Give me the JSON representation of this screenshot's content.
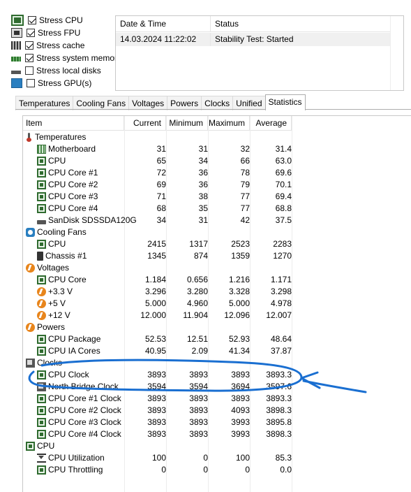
{
  "stress_options": [
    {
      "label": "Stress CPU",
      "checked": true,
      "icon": "cpu-icon"
    },
    {
      "label": "Stress FPU",
      "checked": true,
      "icon": "fpu-icon"
    },
    {
      "label": "Stress cache",
      "checked": true,
      "icon": "cache-icon"
    },
    {
      "label": "Stress system memory",
      "checked": true,
      "icon": "memory-icon"
    },
    {
      "label": "Stress local disks",
      "checked": false,
      "icon": "disk-icon"
    },
    {
      "label": "Stress GPU(s)",
      "checked": false,
      "icon": "monitor-icon"
    }
  ],
  "status_table": {
    "headers": {
      "datetime": "Date & Time",
      "status": "Status"
    },
    "row": {
      "datetime": "14.03.2024 11:22:02",
      "status": "Stability Test: Started"
    }
  },
  "tabs": [
    {
      "label": "Temperatures",
      "active": false
    },
    {
      "label": "Cooling Fans",
      "active": false
    },
    {
      "label": "Voltages",
      "active": false
    },
    {
      "label": "Powers",
      "active": false
    },
    {
      "label": "Clocks",
      "active": false
    },
    {
      "label": "Unified",
      "active": false
    },
    {
      "label": "Statistics",
      "active": true
    }
  ],
  "grid": {
    "headers": {
      "item": "Item",
      "current": "Current",
      "minimum": "Minimum",
      "maximum": "Maximum",
      "average": "Average"
    },
    "rows": [
      {
        "type": "group",
        "label": "Temperatures",
        "icon": "thermometer-icon"
      },
      {
        "type": "item",
        "label": "Motherboard",
        "icon": "motherboard-icon",
        "values": [
          "31",
          "31",
          "32",
          "31.4"
        ]
      },
      {
        "type": "item",
        "label": "CPU",
        "icon": "cpu-chip-icon",
        "values": [
          "65",
          "34",
          "66",
          "63.0"
        ]
      },
      {
        "type": "item",
        "label": "CPU Core #1",
        "icon": "cpu-chip-icon",
        "values": [
          "72",
          "36",
          "78",
          "69.6"
        ]
      },
      {
        "type": "item",
        "label": "CPU Core #2",
        "icon": "cpu-chip-icon",
        "values": [
          "69",
          "36",
          "79",
          "70.1"
        ]
      },
      {
        "type": "item",
        "label": "CPU Core #3",
        "icon": "cpu-chip-icon",
        "values": [
          "71",
          "38",
          "77",
          "69.4"
        ]
      },
      {
        "type": "item",
        "label": "CPU Core #4",
        "icon": "cpu-chip-icon",
        "values": [
          "68",
          "35",
          "77",
          "68.8"
        ]
      },
      {
        "type": "item",
        "label": "SanDisk SDSSDA120G",
        "icon": "disk-icon",
        "values": [
          "34",
          "31",
          "42",
          "37.5"
        ]
      },
      {
        "type": "group",
        "label": "Cooling Fans",
        "icon": "fan-icon"
      },
      {
        "type": "item",
        "label": "CPU",
        "icon": "cpu-chip-icon",
        "values": [
          "2415",
          "1317",
          "2523",
          "2283"
        ]
      },
      {
        "type": "item",
        "label": "Chassis #1",
        "icon": "chassis-icon",
        "values": [
          "1345",
          "874",
          "1359",
          "1270"
        ]
      },
      {
        "type": "group",
        "label": "Voltages",
        "icon": "voltage-icon"
      },
      {
        "type": "item",
        "label": "CPU Core",
        "icon": "cpu-chip-icon",
        "values": [
          "1.184",
          "0.656",
          "1.216",
          "1.171"
        ]
      },
      {
        "type": "item",
        "label": "+3.3 V",
        "icon": "voltage-icon",
        "values": [
          "3.296",
          "3.280",
          "3.328",
          "3.298"
        ]
      },
      {
        "type": "item",
        "label": "+5 V",
        "icon": "voltage-icon",
        "values": [
          "5.000",
          "4.960",
          "5.000",
          "4.978"
        ]
      },
      {
        "type": "item",
        "label": "+12 V",
        "icon": "voltage-icon",
        "values": [
          "12.000",
          "11.904",
          "12.096",
          "12.007"
        ]
      },
      {
        "type": "group",
        "label": "Powers",
        "icon": "voltage-icon"
      },
      {
        "type": "item",
        "label": "CPU Package",
        "icon": "cpu-chip-icon",
        "values": [
          "52.53",
          "12.51",
          "52.93",
          "48.64"
        ]
      },
      {
        "type": "item",
        "label": "CPU IA Cores",
        "icon": "cpu-chip-icon",
        "values": [
          "40.95",
          "2.09",
          "41.34",
          "37.87"
        ]
      },
      {
        "type": "group",
        "label": "Clocks",
        "icon": "clock-chip-icon"
      },
      {
        "type": "item",
        "label": "CPU Clock",
        "icon": "cpu-chip-icon",
        "values": [
          "3893",
          "3893",
          "3893",
          "3893.3"
        ]
      },
      {
        "type": "item",
        "label": "North Bridge Clock",
        "icon": "clock-chip-icon",
        "values": [
          "3594",
          "3594",
          "3694",
          "3597.6"
        ]
      },
      {
        "type": "item",
        "label": "CPU Core #1 Clock",
        "icon": "cpu-chip-icon",
        "values": [
          "3893",
          "3893",
          "3893",
          "3893.3"
        ]
      },
      {
        "type": "item",
        "label": "CPU Core #2 Clock",
        "icon": "cpu-chip-icon",
        "values": [
          "3893",
          "3893",
          "4093",
          "3898.3"
        ]
      },
      {
        "type": "item",
        "label": "CPU Core #3 Clock",
        "icon": "cpu-chip-icon",
        "values": [
          "3893",
          "3893",
          "3993",
          "3895.8"
        ]
      },
      {
        "type": "item",
        "label": "CPU Core #4 Clock",
        "icon": "cpu-chip-icon",
        "values": [
          "3893",
          "3893",
          "3993",
          "3898.3"
        ]
      },
      {
        "type": "group",
        "label": "CPU",
        "icon": "cpu-chip-icon"
      },
      {
        "type": "item",
        "label": "CPU Utilization",
        "icon": "hourglass-icon",
        "values": [
          "100",
          "0",
          "100",
          "85.3"
        ]
      },
      {
        "type": "item",
        "label": "CPU Throttling",
        "icon": "cpu-chip-icon",
        "values": [
          "0",
          "0",
          "0",
          "0.0"
        ]
      }
    ]
  },
  "annotation": {
    "color": "#1a6fd1",
    "icon": "hand-drawn-circle-arrow-icon"
  }
}
